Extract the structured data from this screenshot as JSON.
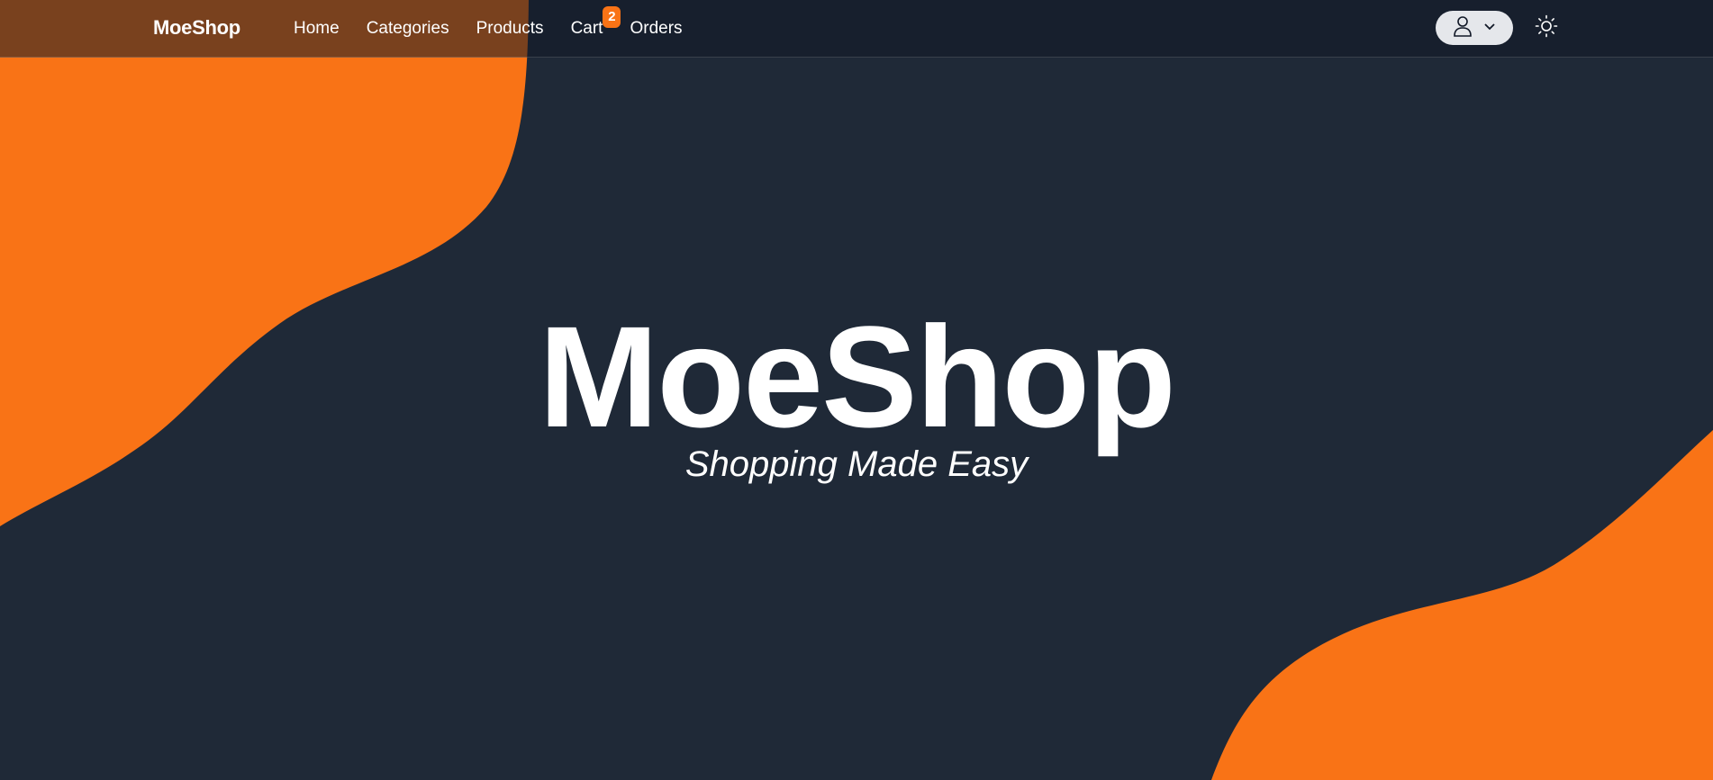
{
  "colors": {
    "background": "#1f2937",
    "accent": "#f97316",
    "text": "#ffffff",
    "user_menu_bg": "#e5e7eb"
  },
  "navbar": {
    "brand": "MoeShop",
    "links": [
      {
        "label": "Home"
      },
      {
        "label": "Categories"
      },
      {
        "label": "Products"
      },
      {
        "label": "Cart"
      },
      {
        "label": "Orders"
      }
    ],
    "cart_count": "2",
    "user_menu": {
      "icon": "user-icon",
      "chevron": "chevron-down-icon"
    },
    "theme_toggle_icon": "sun-icon"
  },
  "hero": {
    "title": "MoeShop",
    "subtitle": "Shopping Made Easy"
  }
}
